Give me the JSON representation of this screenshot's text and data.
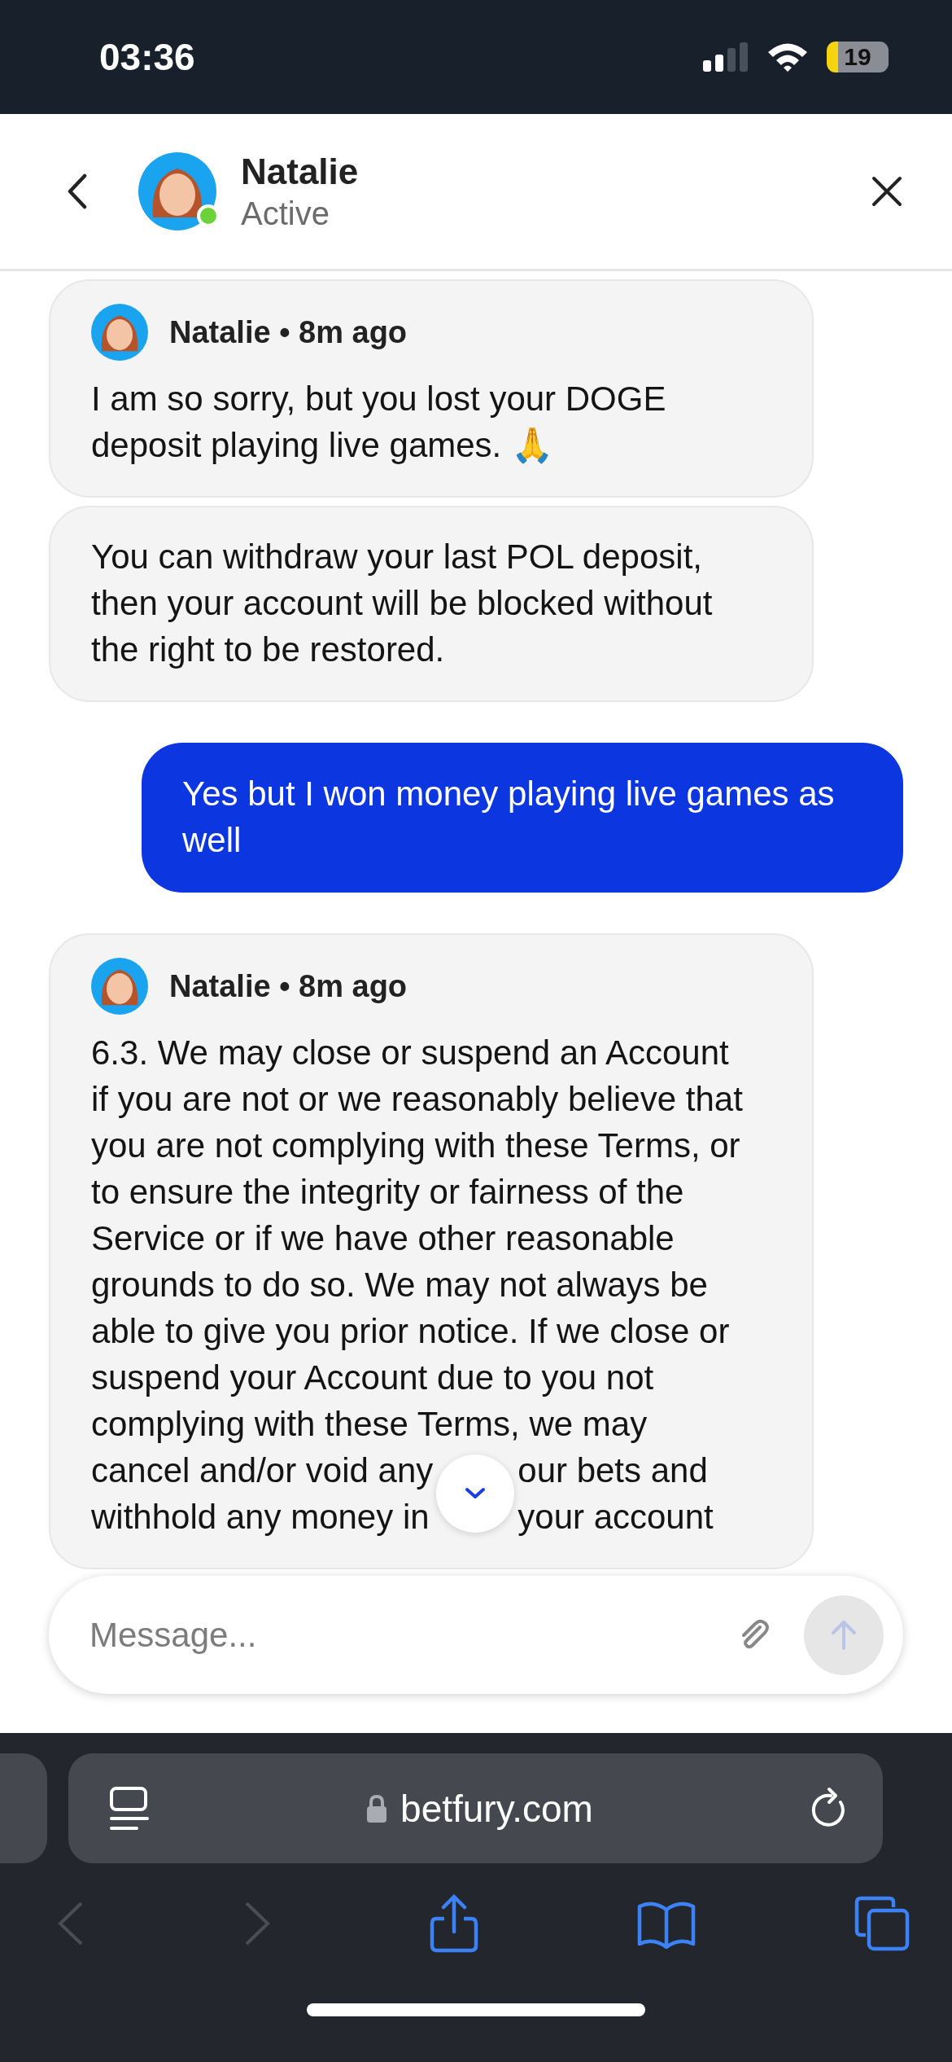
{
  "status_bar": {
    "time": "03:36",
    "battery": "19"
  },
  "header": {
    "name": "Natalie",
    "status": "Active",
    "online": true
  },
  "messages": [
    {
      "kind": "agent",
      "byline": "Natalie • 8m ago",
      "lines": [
        "I am so sorry, but you lost your DOGE",
        "deposit playing live games. 🙏"
      ]
    },
    {
      "kind": "agent",
      "lines": [
        "You can withdraw your last POL deposit,",
        "then your account will be blocked without",
        "the right to be restored."
      ]
    },
    {
      "kind": "user",
      "lines": [
        "Yes but I won money playing live games as",
        "well"
      ]
    },
    {
      "kind": "agent",
      "byline": "Natalie • 8m ago",
      "lines": [
        "6.3. We may close or suspend an Account",
        "if you are not or we reasonably believe that",
        "you are not complying with these Terms, or",
        "to ensure the integrity or fairness of the",
        "Service or if we have other reasonable",
        "grounds to do so. We may not always be",
        "able to give you prior notice. If we close or",
        "suspend your Account due to you not",
        "complying with these Terms, we may",
        [
          "cancel and/or void any",
          "our bets and"
        ],
        [
          "withhold any money in",
          "your account"
        ]
      ]
    }
  ],
  "composer": {
    "placeholder": "Message...",
    "send_disabled": true
  },
  "browser": {
    "url": "betfury.com",
    "back_disabled": true,
    "forward_disabled": true
  }
}
